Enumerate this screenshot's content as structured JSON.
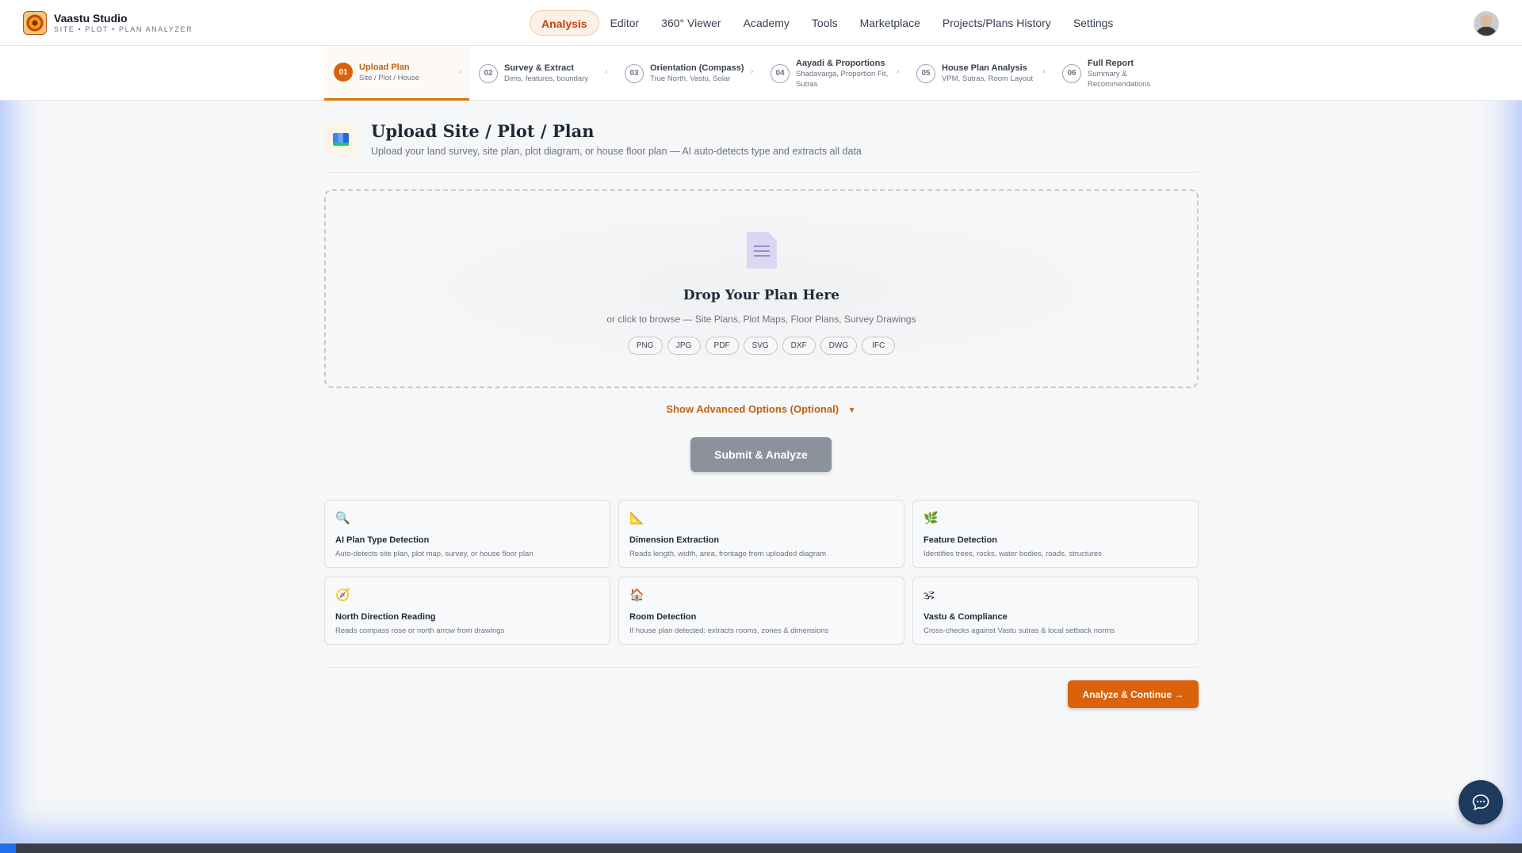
{
  "brand": {
    "title": "Vaastu Studio",
    "subtitle": "SITE • PLOT • PLAN ANALYZER"
  },
  "nav": {
    "items": [
      {
        "label": "Analysis",
        "active": true
      },
      {
        "label": "Editor"
      },
      {
        "label": "360° Viewer"
      },
      {
        "label": "Academy"
      },
      {
        "label": "Tools"
      },
      {
        "label": "Marketplace"
      },
      {
        "label": "Projects/Plans History"
      },
      {
        "label": "Settings"
      }
    ]
  },
  "steps": [
    {
      "num": "01",
      "title": "Upload Plan",
      "sub": "Site / Plot / House",
      "active": true
    },
    {
      "num": "02",
      "title": "Survey & Extract",
      "sub": "Dims, features, boundary"
    },
    {
      "num": "03",
      "title": "Orientation (Compass)",
      "sub": "True North, Vastu, Solar"
    },
    {
      "num": "04",
      "title": "Aayadi & Proportions",
      "sub": "Shadavarga, Proportion Fit,",
      "sub2": "Sutras"
    },
    {
      "num": "05",
      "title": "House Plan Analysis",
      "sub": "VPM, Sutras, Room Layout"
    },
    {
      "num": "06",
      "title": "Full Report",
      "sub": "Summary &",
      "sub2": "Recommendations"
    }
  ],
  "page": {
    "title": "Upload Site / Plot / Plan",
    "subtitle": "Upload your land survey, site plan, plot diagram, or house floor plan — AI auto-detects type and extracts all data"
  },
  "dropzone": {
    "title": "Drop Your Plan Here",
    "subtitle": "or click to browse — Site Plans, Plot Maps, Floor Plans, Survey Drawings",
    "formats": [
      "PNG",
      "JPG",
      "PDF",
      "SVG",
      "DXF",
      "DWG",
      "IFC"
    ]
  },
  "advanced_label": "Show Advanced Options (Optional)",
  "advanced_arrow": "▼",
  "submit_label": "Submit & Analyze",
  "features": [
    {
      "icon": "magnifier-icon",
      "glyph": "🔍",
      "title": "AI Plan Type Detection",
      "desc": "Auto-detects site plan, plot map, survey, or house floor plan"
    },
    {
      "icon": "triangle-ruler-icon",
      "glyph": "📐",
      "title": "Dimension Extraction",
      "desc": "Reads length, width, area, frontage from uploaded diagram"
    },
    {
      "icon": "plant-icon",
      "glyph": "🌿",
      "title": "Feature Detection",
      "desc": "Identifies trees, rocks, water bodies, roads, structures"
    },
    {
      "icon": "compass-icon",
      "glyph": "🧭",
      "title": "North Direction Reading",
      "desc": "Reads compass rose or north arrow from drawings"
    },
    {
      "icon": "house-icon",
      "glyph": "🏠",
      "title": "Room Detection",
      "desc": "If house plan detected: extracts rooms, zones & dimensions"
    },
    {
      "icon": "om-icon",
      "glyph": "🕉",
      "title": "Vastu & Compliance",
      "desc": "Cross-checks against Vastu sutras & local setback norms"
    }
  ],
  "continue_label": "Analyze & Continue →",
  "colors": {
    "accent": "#d9620b",
    "chat": "#1e3a5f"
  }
}
